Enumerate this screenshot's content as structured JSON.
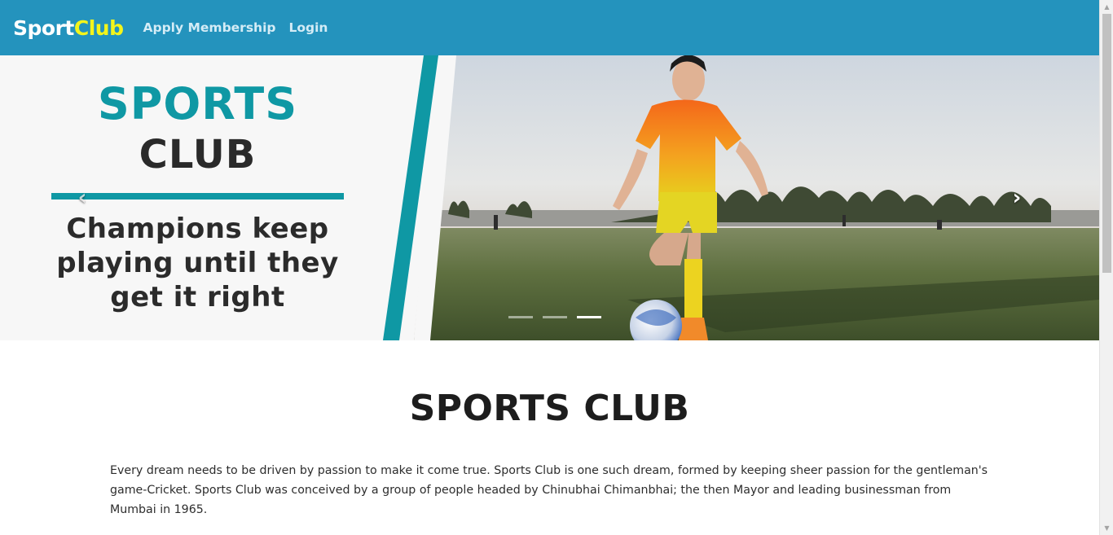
{
  "navbar": {
    "brand_part1": "Sport",
    "brand_part2": "Club",
    "links": [
      {
        "label": "Apply Membership"
      },
      {
        "label": "Login"
      }
    ],
    "background_color": "#2493bd",
    "brand_accent_color": "#f3f51b"
  },
  "hero": {
    "title_line1": "SPORTS",
    "title_line2": "CLUB",
    "tagline": "Champions keep playing until they get it right",
    "accent_color": "#0f98a4",
    "prev_icon": "‹",
    "next_icon": "›",
    "slides": 3,
    "active_slide": 3
  },
  "content": {
    "title": "SPORTS CLUB",
    "paragraph": "Every dream needs to be driven by passion to make it come true. Sports Club is one such dream, formed by keeping sheer passion for the gentleman's game-Cricket. Sports Club was conceived by a group of people headed by Chinubhai Chimanbhai; the then Mayor and leading businessman from Mumbai in 1965."
  },
  "icons": {
    "prev": "chevron-left-icon",
    "next": "chevron-right-icon",
    "scroll_up": "triangle-up-icon",
    "scroll_down": "triangle-down-icon"
  }
}
